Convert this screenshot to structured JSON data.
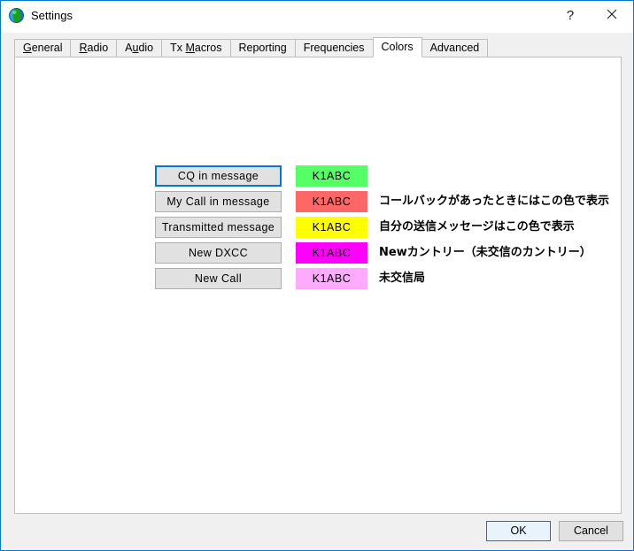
{
  "window": {
    "title": "Settings",
    "icon": "globe-icon",
    "accent_color": "#0078d7",
    "controls": {
      "help_label": "?",
      "close_label": "×"
    }
  },
  "tabs": [
    {
      "label": "General",
      "accel": "G",
      "active": false
    },
    {
      "label": "Radio",
      "accel": "R",
      "active": false
    },
    {
      "label": "Audio",
      "accel": "u",
      "active": false
    },
    {
      "label": "Tx Macros",
      "accel": "M",
      "active": false
    },
    {
      "label": "Reporting",
      "accel": "",
      "active": false
    },
    {
      "label": "Frequencies",
      "accel": "",
      "active": false
    },
    {
      "label": "Colors",
      "accel": "",
      "active": true
    },
    {
      "label": "Advanced",
      "accel": "",
      "active": false
    }
  ],
  "colors_tab": {
    "rows": [
      {
        "button_label": "CQ in message",
        "focused": true,
        "sample_text": "K1ABC",
        "swatch_color": "#55ff66",
        "sample_text_color": "#000000",
        "note": ""
      },
      {
        "button_label": "My Call in message",
        "focused": false,
        "sample_text": "K1ABC",
        "swatch_color": "#ff6666",
        "sample_text_color": "#000000",
        "note": "コールバックがあったときにはこの色で表示"
      },
      {
        "button_label": "Transmitted message",
        "focused": false,
        "sample_text": "K1ABC",
        "swatch_color": "#ffff00",
        "sample_text_color": "#000000",
        "note": "自分の送信メッセージはこの色で表示"
      },
      {
        "button_label": "New DXCC",
        "focused": false,
        "sample_text": "K1ABC",
        "swatch_color": "#ff00ff",
        "sample_text_color": "#000000",
        "note": "Newカントリー（未交信のカントリー）"
      },
      {
        "button_label": "New Call",
        "focused": false,
        "sample_text": "K1ABC",
        "swatch_color": "#ffaaff",
        "sample_text_color": "#000000",
        "note": "未交信局"
      }
    ]
  },
  "footer": {
    "ok_label": "OK",
    "cancel_label": "Cancel"
  }
}
